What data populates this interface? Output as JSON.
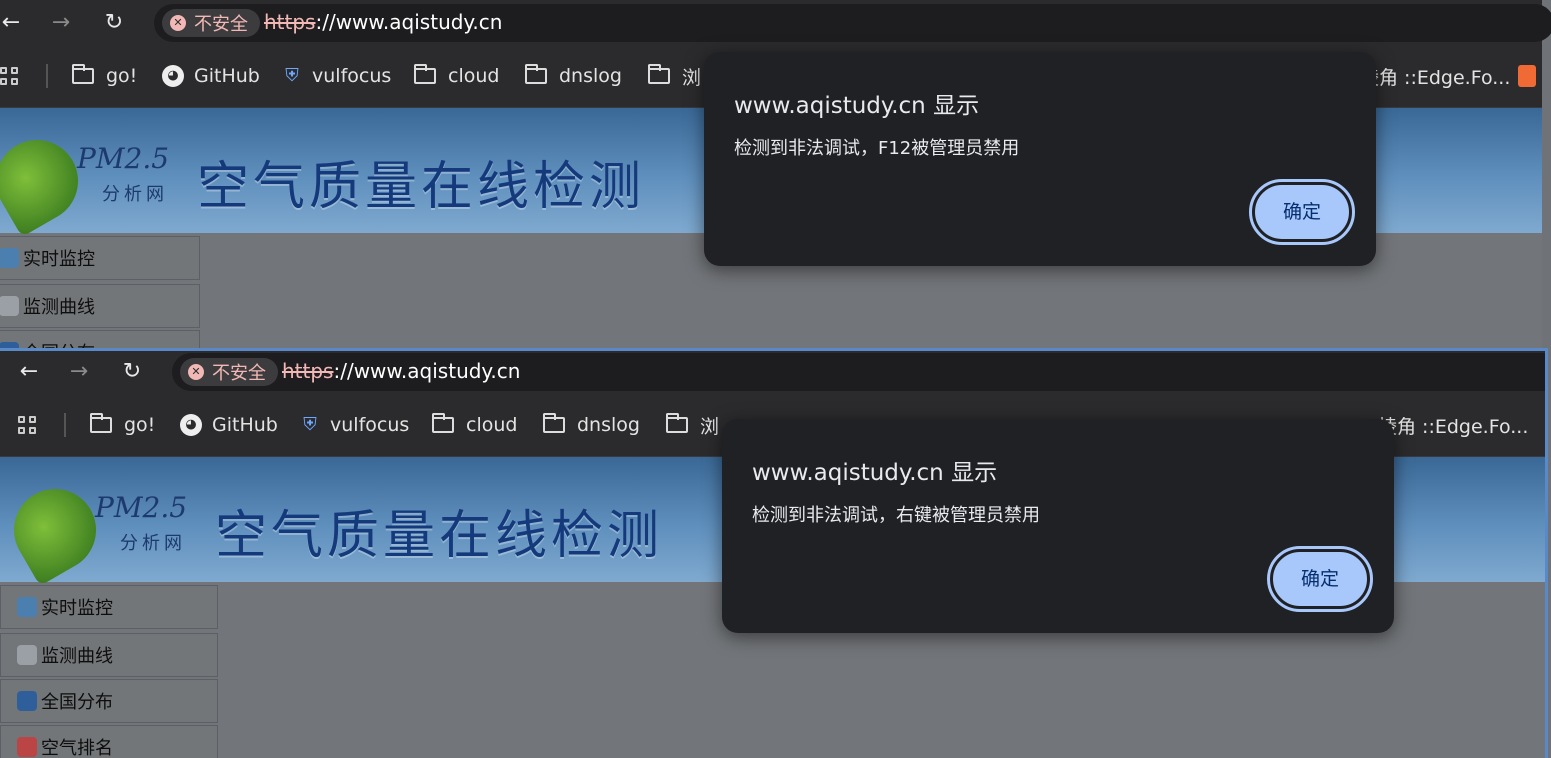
{
  "browser": {
    "insecure_label": "不安全",
    "url_scheme": "https",
    "url_rest": "://www.aqistudy.cn",
    "back_icon": "arrow-left-icon",
    "forward_icon": "arrow-right-icon",
    "reload_icon": "reload-icon"
  },
  "bookmarks": {
    "items": [
      "go!",
      "GitHub",
      "vulfocus",
      "cloud",
      "dnslog",
      "浏"
    ],
    "right_item": "棱角 ::Edge.Fo..."
  },
  "page": {
    "logo_pm": "PM2.5",
    "logo_sub": "分析网",
    "site_title": "空气质量在线检测",
    "menu": [
      "实时监控",
      "监测曲线",
      "全国分布",
      "空气排名"
    ]
  },
  "dialogs": {
    "top": {
      "title": "www.aqistudy.cn 显示",
      "message": "检测到非法调试，F12被管理员禁用",
      "ok": "确定"
    },
    "bottom": {
      "title": "www.aqistudy.cn 显示",
      "message": "检测到非法调试，右键被管理员禁用",
      "ok": "确定"
    }
  }
}
